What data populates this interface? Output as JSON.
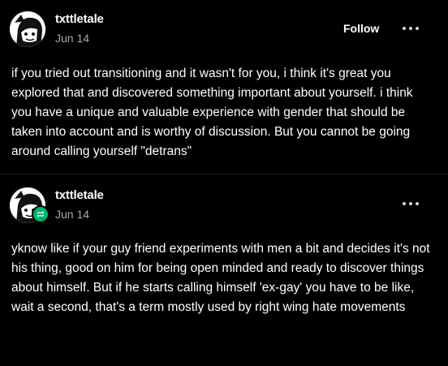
{
  "colors": {
    "background": "#000000",
    "text": "#ffffff",
    "muted": "#a8a8a8",
    "reblog_green": "#00b36b"
  },
  "posts": [
    {
      "username": "txttletale",
      "date": "Jun 14",
      "follow_label": "Follow",
      "more_icon": "ellipsis-icon",
      "body": "if you tried out transitioning and it wasn't for you, i think it's great you explored that and discovered something important about yourself. i think you have a unique and valuable experience with gender that should be taken into account and is worthy of discussion. But you cannot be going around calling yourself \"detrans\""
    },
    {
      "username": "txttletale",
      "date": "Jun 14",
      "badge_icon": "reblog-icon",
      "more_icon": "ellipsis-icon",
      "body": "yknow like if your guy friend experiments with men a bit and decides it's not his thing, good on him for being open minded and ready to discover things about himself. But if he starts calling himself 'ex-gay' you have to be like, wait a second, that's a term mostly used by right wing hate movements"
    }
  ]
}
